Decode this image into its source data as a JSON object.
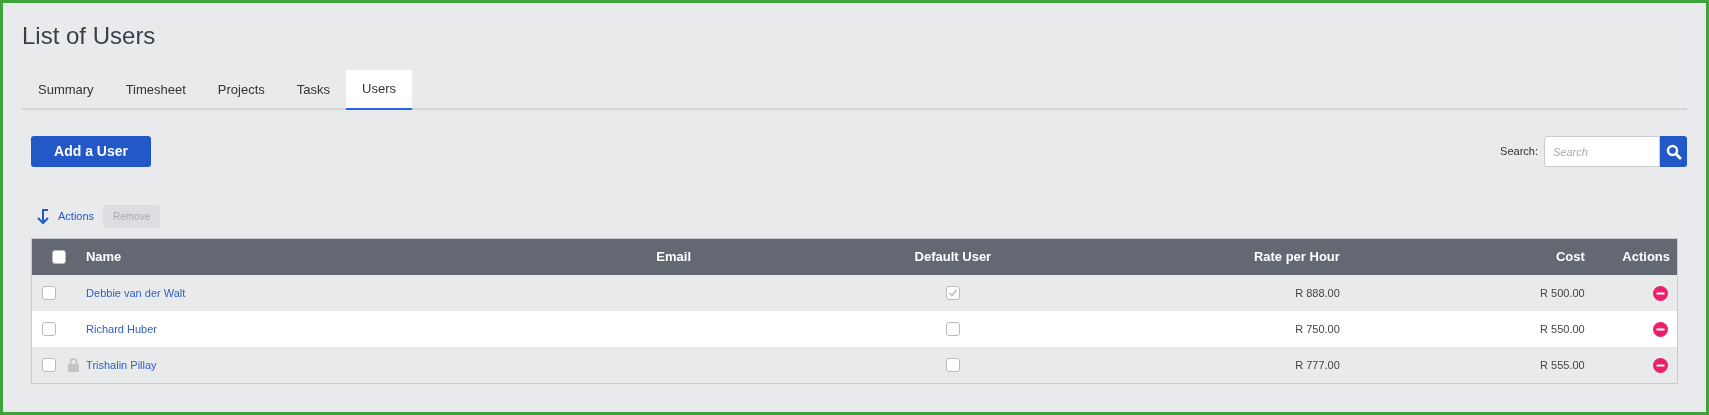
{
  "title": "List of Users",
  "tabs": [
    {
      "label": "Summary",
      "selected": false
    },
    {
      "label": "Timesheet",
      "selected": false
    },
    {
      "label": "Projects",
      "selected": false
    },
    {
      "label": "Tasks",
      "selected": false
    },
    {
      "label": "Users",
      "selected": true
    }
  ],
  "add_button": "Add a User",
  "search": {
    "label": "Search:",
    "placeholder": "Search"
  },
  "actions": {
    "label": "Actions",
    "remove": "Remove",
    "remove_disabled": true
  },
  "table": {
    "select_all_checked": false,
    "columns": [
      "Name",
      "Email",
      "Default User",
      "Rate per Hour",
      "Cost",
      "Actions"
    ],
    "rows": [
      {
        "checked": false,
        "locked": false,
        "name": "Debbie van der Walt",
        "default_user": true,
        "rate": "R 888.00",
        "cost": "R 500.00"
      },
      {
        "checked": false,
        "locked": false,
        "name": "Richard Huber",
        "default_user": false,
        "rate": "R 750.00",
        "cost": "R 550.00"
      },
      {
        "checked": false,
        "locked": true,
        "name": "Trishalin Pillay",
        "default_user": false,
        "rate": "R 777.00",
        "cost": "R 555.00"
      }
    ]
  }
}
